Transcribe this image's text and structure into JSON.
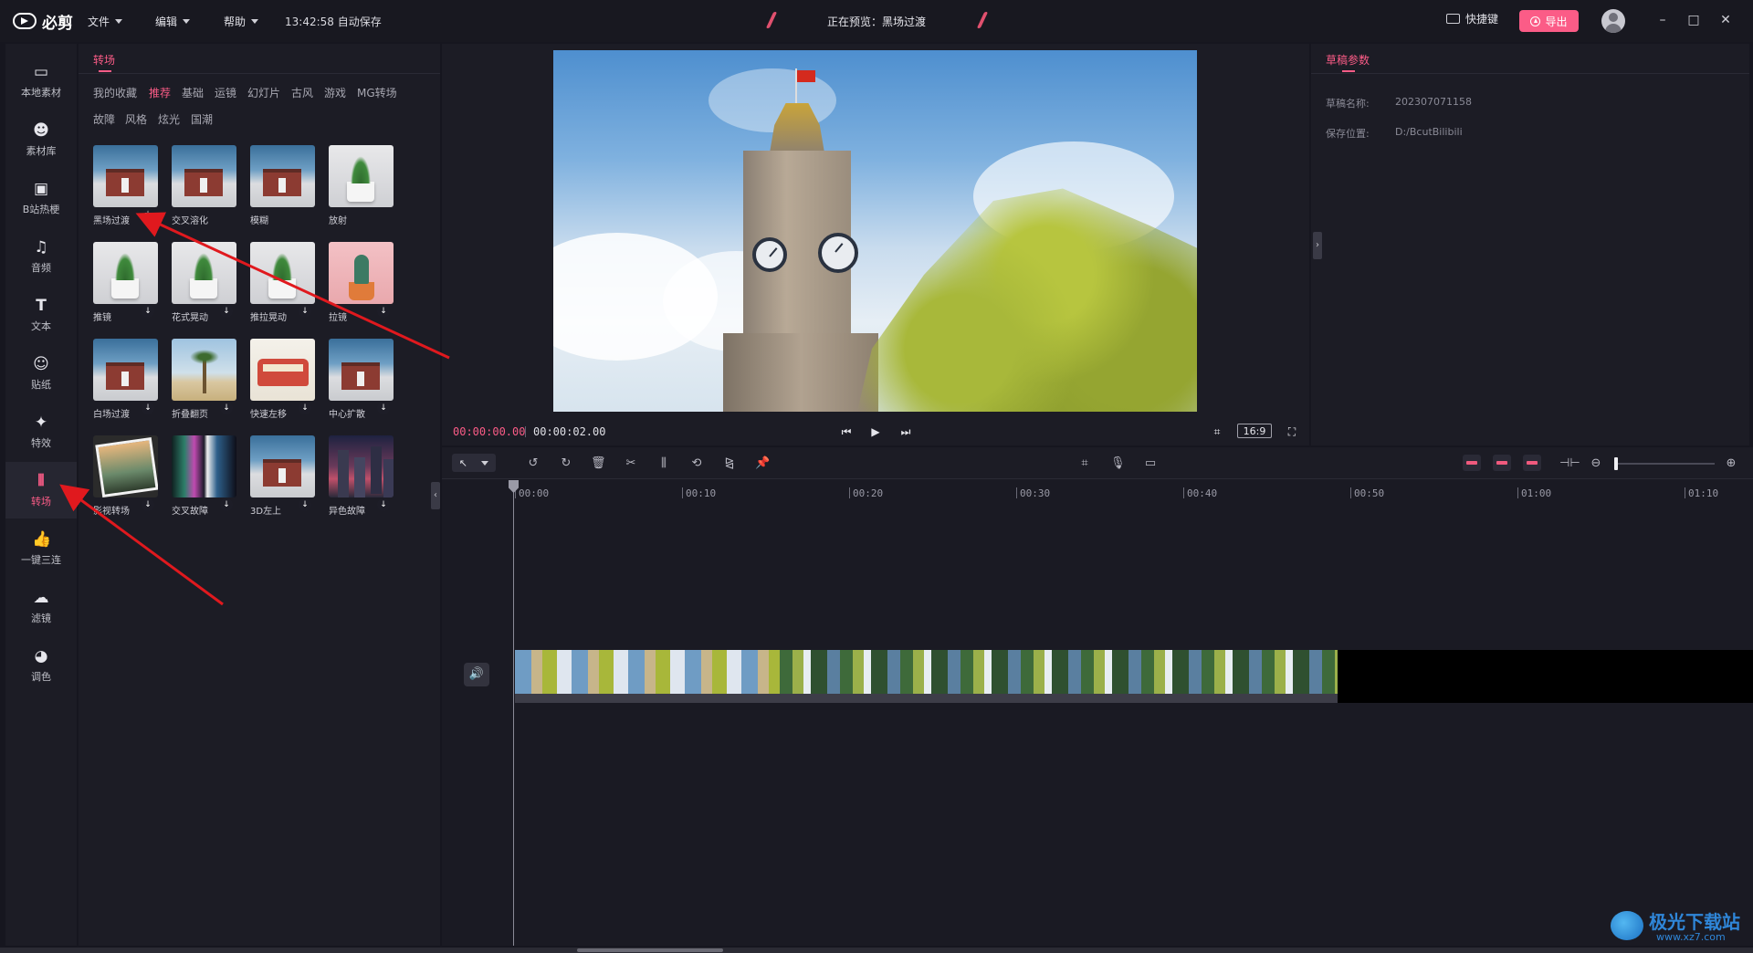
{
  "topbar": {
    "app_name": "必剪",
    "menus": [
      "文件",
      "编辑",
      "帮助"
    ],
    "autosave": "13:42:58 自动保存",
    "preview_title": "正在预览：黑场过渡",
    "shortcut_label": "快捷键",
    "export_label": "导出"
  },
  "sidebar": {
    "items": [
      {
        "label": "本地素材",
        "icon": "folder-icon"
      },
      {
        "label": "素材库",
        "icon": "library-icon"
      },
      {
        "label": "B站热梗",
        "icon": "bilibili-tv-icon"
      },
      {
        "label": "音频",
        "icon": "music-note-icon"
      },
      {
        "label": "文本",
        "icon": "text-icon"
      },
      {
        "label": "贴纸",
        "icon": "sticker-icon"
      },
      {
        "label": "特效",
        "icon": "effects-icon"
      },
      {
        "label": "转场",
        "icon": "transition-icon",
        "active": true
      },
      {
        "label": "一键三连",
        "icon": "thumbs-up-icon"
      },
      {
        "label": "滤镜",
        "icon": "filter-icon"
      },
      {
        "label": "调色",
        "icon": "palette-icon"
      }
    ]
  },
  "panel": {
    "title": "转场",
    "categories_row1": [
      "我的收藏",
      "推荐",
      "基础",
      "运镜",
      "幻灯片",
      "古风",
      "游戏",
      "MG转场"
    ],
    "categories_row2": [
      "故障",
      "风格",
      "炫光",
      "国潮"
    ],
    "active_category": "推荐",
    "tiles": [
      {
        "label": "黑场过渡",
        "art": "house",
        "download": false,
        "favorite": true
      },
      {
        "label": "交叉溶化",
        "art": "house",
        "download": false
      },
      {
        "label": "模糊",
        "art": "house",
        "download": false
      },
      {
        "label": "放射",
        "art": "plant",
        "download": false
      },
      {
        "label": "推镜",
        "art": "plant",
        "download": true
      },
      {
        "label": "花式晃动",
        "art": "plant",
        "download": true
      },
      {
        "label": "推拉晃动",
        "art": "plant",
        "download": true
      },
      {
        "label": "拉镜",
        "art": "cactus",
        "download": true
      },
      {
        "label": "白场过渡",
        "art": "house",
        "download": true
      },
      {
        "label": "折叠翻页",
        "art": "palm",
        "download": true
      },
      {
        "label": "快速左移",
        "art": "bus",
        "download": true
      },
      {
        "label": "中心扩散",
        "art": "house",
        "download": true
      },
      {
        "label": "影视转场",
        "art": "photo",
        "download": true
      },
      {
        "label": "交叉故障",
        "art": "glitch",
        "download": true
      },
      {
        "label": "3D左上",
        "art": "house",
        "download": true
      },
      {
        "label": "异色故障",
        "art": "city",
        "download": true
      }
    ]
  },
  "preview": {
    "current_time": "00:00:00.00",
    "total_time": "00:00:02.00",
    "aspect_ratio": "16:9"
  },
  "props": {
    "title": "草稿参数",
    "draft_name_label": "草稿名称:",
    "draft_name": "202307071158",
    "save_location_label": "保存位置:",
    "save_location": "D:/BcutBilibili"
  },
  "timeline": {
    "ruler_labels": [
      "00:00",
      "00:10",
      "00:20",
      "00:30",
      "00:40",
      "00:50",
      "01:00",
      "01:10"
    ]
  },
  "watermark": {
    "text": "极光下载站",
    "url": "www.xz7.com"
  },
  "colors": {
    "accent": "#fb5c87",
    "background": "#16161f",
    "panel": "#1c1c25",
    "annotation_arrow": "#e0191e"
  }
}
